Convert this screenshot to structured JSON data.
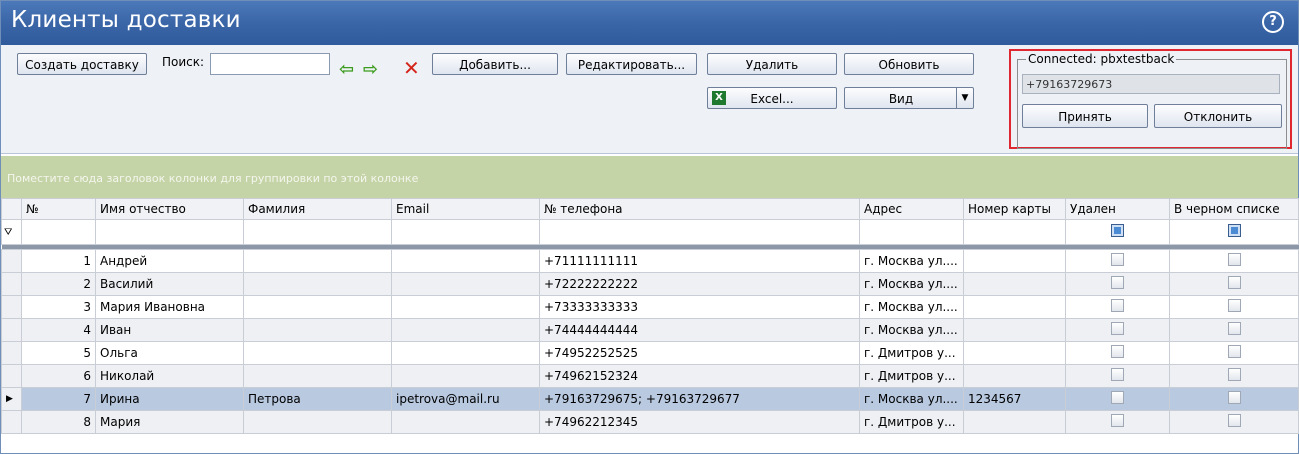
{
  "window": {
    "title": "Клиенты доставки",
    "help_icon": "help-icon"
  },
  "toolbar": {
    "create_delivery": "Создать доставку",
    "search_label": "Поиск:",
    "search_value": "",
    "add": "Добавить...",
    "edit": "Редактировать...",
    "delete": "Удалить",
    "refresh": "Обновить",
    "excel": "Excel...",
    "view": "Вид"
  },
  "call_panel": {
    "legend": "Connected: pbxtestback",
    "phone": "+79163729673",
    "accept": "Принять",
    "reject": "Отклонить"
  },
  "group_hint": "Поместите сюда заголовок колонки для группировки по этой колонке",
  "columns": [
    "№",
    "Имя отчество",
    "Фамилия",
    "Email",
    "№ телефона",
    "Адрес",
    "Номер карты",
    "Удален",
    "В черном списке"
  ],
  "rows": [
    {
      "n": "1",
      "name": "Андрей",
      "surname": "",
      "email": "",
      "phone": "+71111111111",
      "address": "г. Москва ул....",
      "card": ""
    },
    {
      "n": "2",
      "name": "Василий",
      "surname": "",
      "email": "",
      "phone": "+72222222222",
      "address": "г. Москва ул....",
      "card": ""
    },
    {
      "n": "3",
      "name": "Мария Ивановна",
      "surname": "",
      "email": "",
      "phone": "+73333333333",
      "address": "г. Москва ул....",
      "card": ""
    },
    {
      "n": "4",
      "name": "Иван",
      "surname": "",
      "email": "",
      "phone": "+74444444444",
      "address": "г. Москва ул....",
      "card": ""
    },
    {
      "n": "5",
      "name": "Ольга",
      "surname": "",
      "email": "",
      "phone": "+74952252525",
      "address": "г. Дмитров у...",
      "card": ""
    },
    {
      "n": "6",
      "name": "Николай",
      "surname": "",
      "email": "",
      "phone": "+74962152324",
      "address": "г. Дмитров у...",
      "card": ""
    },
    {
      "n": "7",
      "name": "Ирина",
      "surname": "Петрова",
      "email": "ipetrova@mail.ru",
      "phone": "+79163729675; +79163729677",
      "address": "г. Москва ул....",
      "card": "1234567"
    },
    {
      "n": "8",
      "name": "Мария",
      "surname": "",
      "email": "",
      "phone": "+74962212345",
      "address": "г. Дмитров у...",
      "card": ""
    }
  ]
}
